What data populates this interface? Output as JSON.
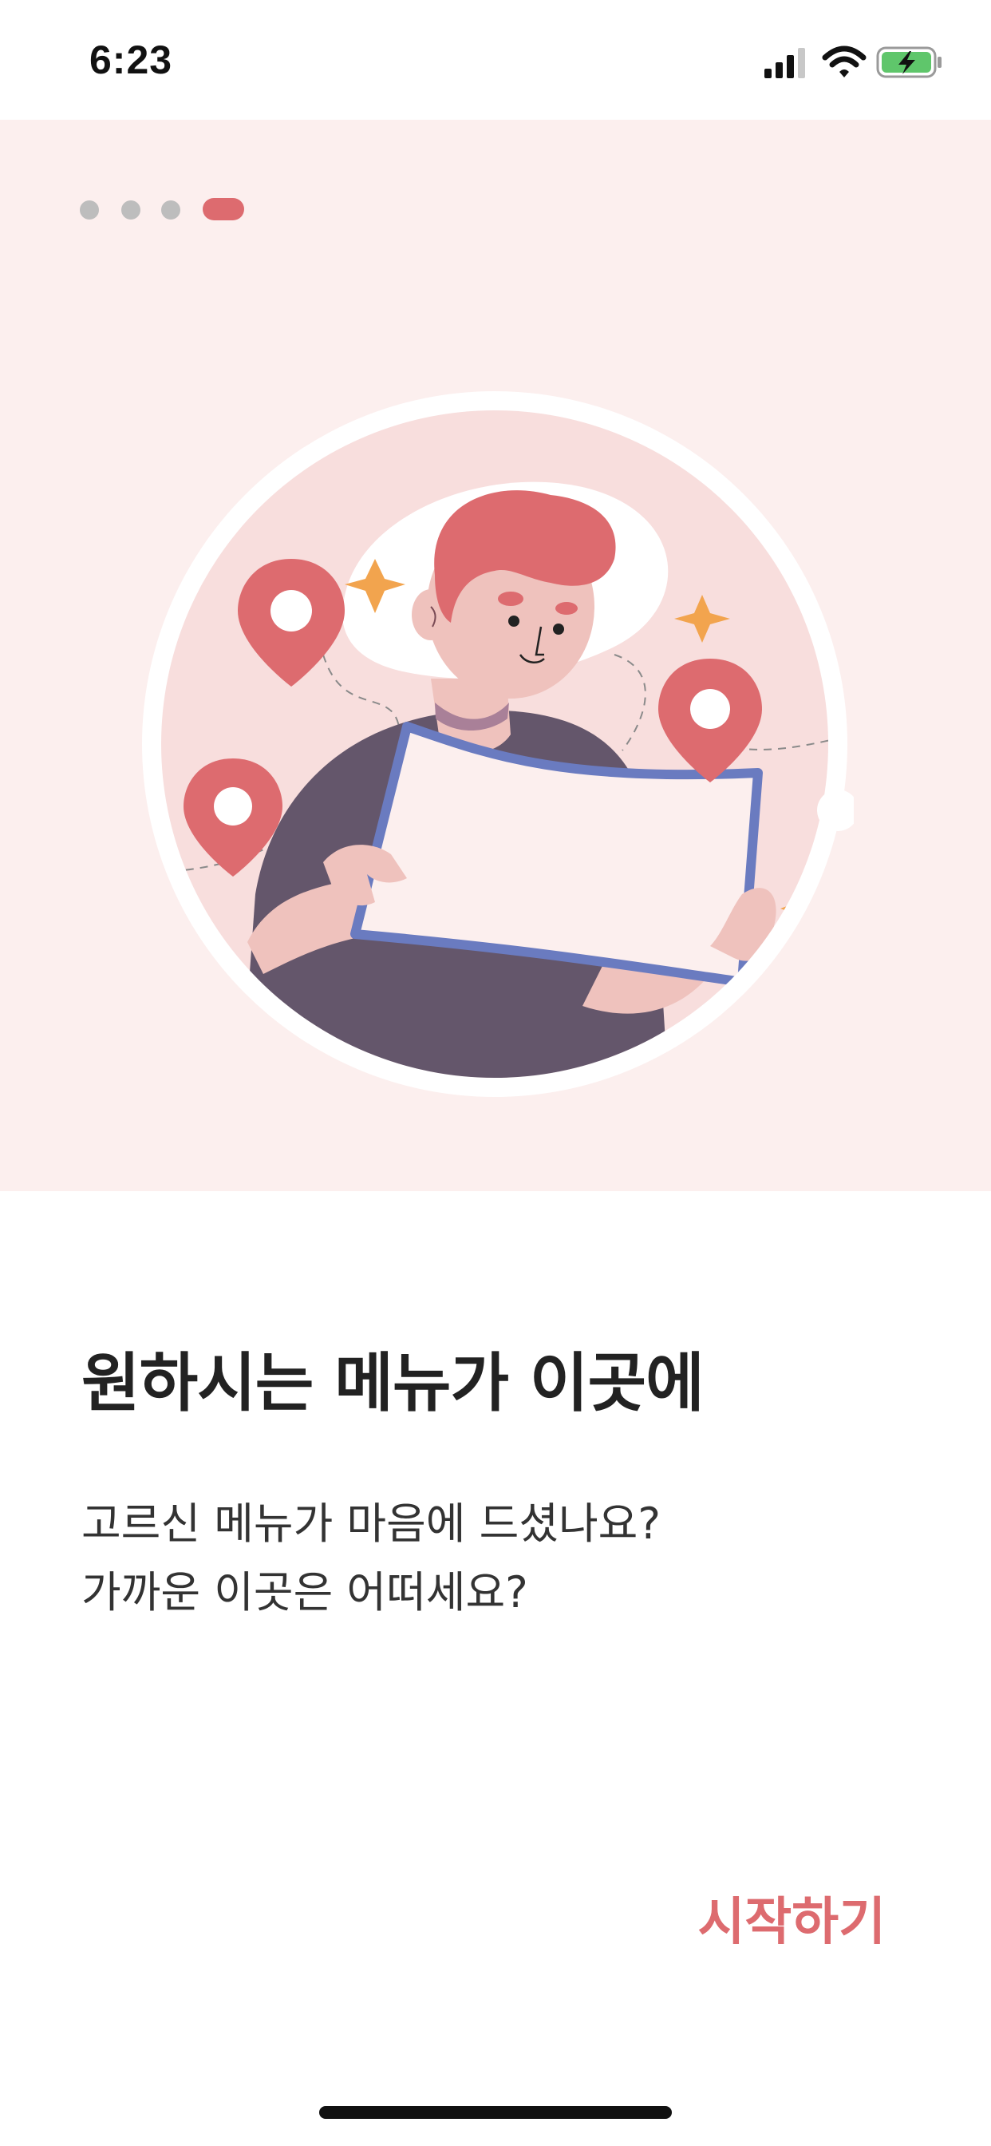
{
  "status_bar": {
    "time": "6:23",
    "icons": [
      "cellular-signal-icon",
      "wifi-icon",
      "battery-charging-icon"
    ]
  },
  "pager": {
    "total_pages": 4,
    "current_page": 4
  },
  "illustration": {
    "icons": [
      "map-pin-icon",
      "sparkle-icon"
    ]
  },
  "content": {
    "title": "원하시는 메뉴가 이곳에",
    "body_line_1": "고르신 메뉴가 마음에 드셨나요?",
    "body_line_2": "가까운 이곳은 어떠세요?"
  },
  "actions": {
    "start_label": "시작하기"
  },
  "colors": {
    "accent": "#dd6b6f",
    "hero_background": "#fcefee",
    "dot_inactive": "#bdbdbd",
    "sparkle": "#f2a44e",
    "map_frame": "#6a7bc0",
    "shirt": "#64566b",
    "battery": "#5fc66b"
  }
}
